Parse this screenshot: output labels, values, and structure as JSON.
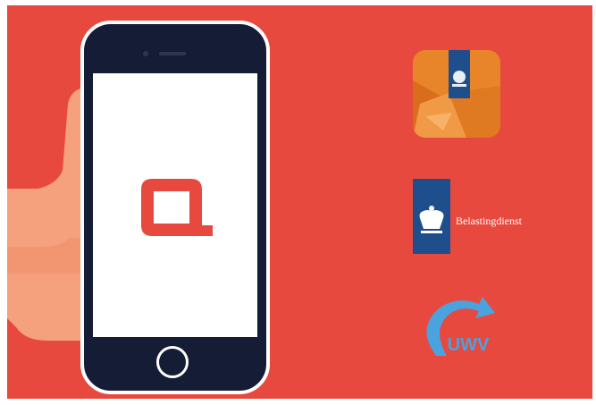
{
  "logos": {
    "belastingdienst": "Belastingdienst",
    "uwv": "UWV"
  },
  "icons": {
    "app_logo": "square-q-logo-icon",
    "mail_app": "mail-envelope-coat-of-arms-icon",
    "belastingdienst": "belastingdienst-coat-of-arms-icon",
    "uwv": "uwv-arc-arrow-logo"
  },
  "colors": {
    "background": "#e8493e",
    "phone_body": "#151c35",
    "hand": "#f5a17d",
    "app_logo": "#e8493e",
    "mail_app_orange": "#e8842a",
    "belastingdienst_blue": "#1f4e8c",
    "uwv_blue": "#4aa3df"
  }
}
